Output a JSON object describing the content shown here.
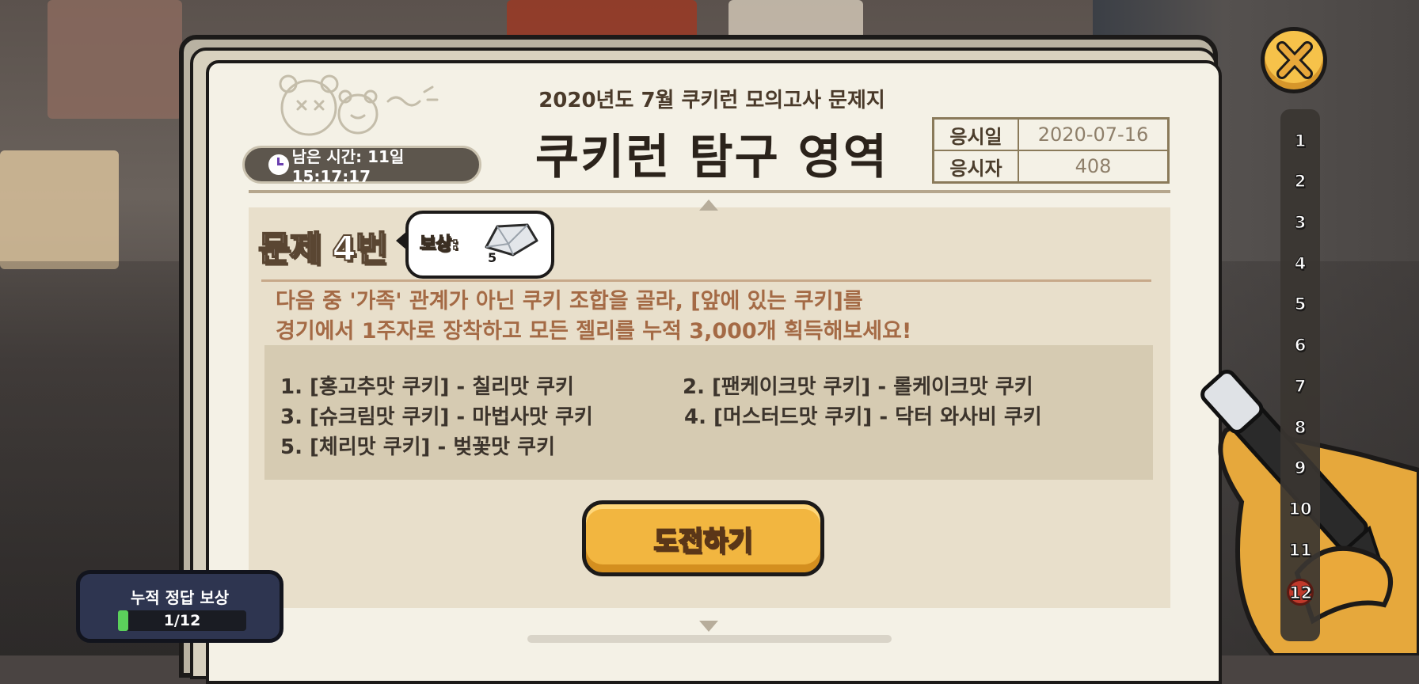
{
  "exam": {
    "subtitle": "2020년도 7월 쿠키런 모의고사 문제지",
    "title": "쿠키런 탐구 영역",
    "timer_text": "남은 시간: 11일15:17:17",
    "info": {
      "date_label": "응시일",
      "date_value": "2020-07-16",
      "taker_label": "응시자",
      "taker_value": "408"
    }
  },
  "question": {
    "label": "문제 4번",
    "reward_label": "보상:",
    "reward_count": "5",
    "reward_icon": "crystal-icon",
    "description_line1": "다음 중 '가족' 관계가 아닌 쿠키 조합을 골라, [앞에 있는 쿠키]를",
    "description_line2": "경기에서 1주자로 장착하고 모든 젤리를 누적 3,000개 획득해보세요!",
    "choices": [
      "1. [홍고추맛 쿠키] - 칠리맛 쿠키",
      "2. [팬케이크맛 쿠키] - 롤케이크맛 쿠키",
      "3. [슈크림맛 쿠키] - 마법사맛 쿠키",
      "4. [머스터드맛 쿠키] - 닥터 와사비 쿠키",
      "5. [체리맛 쿠키] - 벚꽃맛 쿠키"
    ],
    "challenge_button": "도전하기"
  },
  "question_nav": [
    "1",
    "2",
    "3",
    "4",
    "5",
    "6",
    "7",
    "8",
    "9",
    "10",
    "11",
    "12"
  ],
  "current_marker": "12",
  "cumulative": {
    "title": "누적 정답 보상",
    "progress_text": "1/12",
    "progress_fraction": 0.083
  },
  "colors": {
    "paper": "#f4f1e6",
    "button": "#f2b640",
    "accent_text": "#a46a45",
    "progress": "#5bd15b"
  },
  "icons": [
    "close-icon",
    "clock-icon",
    "crystal-icon",
    "pen-icon"
  ]
}
